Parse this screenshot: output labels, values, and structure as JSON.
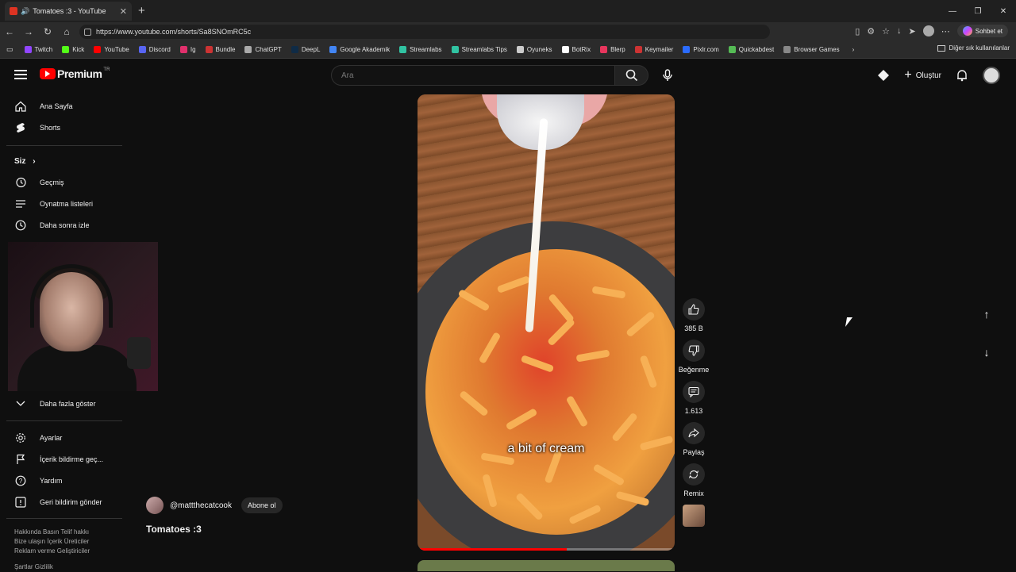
{
  "browser": {
    "tab_title": "Tomatoes :3 - YouTube",
    "url": "https://www.youtube.com/shorts/Sa8SNOmRC5c",
    "copilot_label": "Sohbet et",
    "bookmarks": [
      "Twitch",
      "Kick",
      "YouTube",
      "Discord",
      "Ig",
      "Bundle",
      "ChatGPT",
      "DeepL",
      "Google Akademik",
      "Streamlabs",
      "Streamlabs Tips",
      "Oyuneks",
      "BotRix",
      "Blerp",
      "Keymailer",
      "Pixlr.com",
      "Quickabdest",
      "Browser Games"
    ],
    "bookmark_colors": [
      "#9146ff",
      "#53fc18",
      "#ff0000",
      "#5865f2",
      "#e1306c",
      "#cc3333",
      "#aaaaaa",
      "#0f2b46",
      "#4285f4",
      "#31c3a2",
      "#31c3a2",
      "#cccccc",
      "#ffffff",
      "#e8365d",
      "#cc3333",
      "#2b6cff",
      "#55bb55",
      "#888888"
    ],
    "other_bookmarks": "Diğer sık kullanılanlar"
  },
  "youtube": {
    "logo_text": "Premium",
    "logo_region": "TR",
    "search_placeholder": "Ara",
    "create_label": "Oluştur"
  },
  "sidebar": {
    "home": "Ana Sayfa",
    "shorts": "Shorts",
    "you": "Siz",
    "history": "Geçmiş",
    "playlists": "Oynatma listeleri",
    "watch_later": "Daha sonra izle",
    "show_more": "Daha fazla göster",
    "settings": "Ayarlar",
    "report_history": "İçerik bildirme geç...",
    "help": "Yardım",
    "feedback": "Geri bildirim gönder",
    "footer1": "Hakkında  Basın  Telif hakkı",
    "footer2": "Bize ulaşın  İçerik Üreticiler",
    "footer3": "Reklam verme  Geliştiriciler",
    "footer4": "Şartlar  Gizlilik"
  },
  "short": {
    "caption": "a bit of cream",
    "progress_fraction": 0.58,
    "channel_handle": "@mattthecatcook",
    "subscribe_label": "Abone ol",
    "title": "Tomatoes :3",
    "likes": "385 B",
    "dislike_label": "Beğenme",
    "comments": "1.613",
    "share_label": "Paylaş",
    "remix_label": "Remix"
  }
}
